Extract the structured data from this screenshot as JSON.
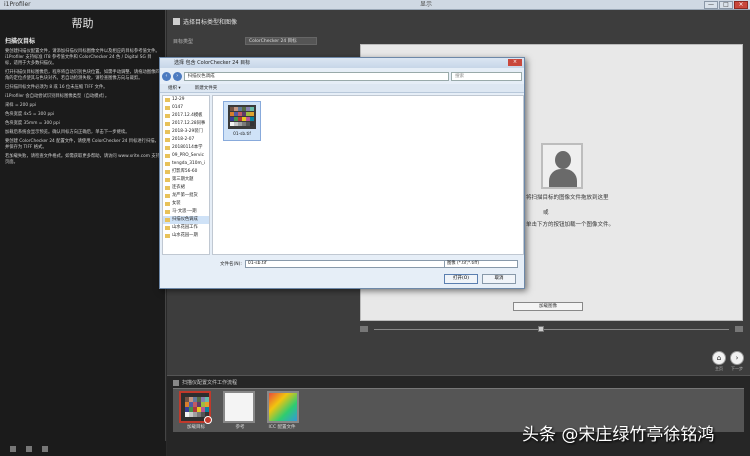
{
  "window": {
    "title": "i1Profiler",
    "center_title": "显示",
    "buttons": [
      "—",
      "□",
      "×"
    ]
  },
  "help": {
    "title": "帮助",
    "section": "扫描仪目标",
    "paragraphs": [
      "要创建扫描仪配置文件，请添加扫描仪目标图像文件以及相应的目标参考值文件。i1Profiler 支持标准 IT8 参考值文件和 ColorChecker 24 色 / Digital SG 目标，适用于大多数扫描仪。",
      "打开扫描仪目标图像后，程序将自动识别色块位置。如需手动调整，请拖动图像四角的定位点使其与色块对齐。若自动检测失败，请检查图像方向与裁剪。",
      "已扫描目标文件必须为 8 或 16 位未压缩 TIFF 文件。",
      "i1Profiler 会自动尝试识别目标图像类型（自动模式）。",
      "采样 = 200 ppi",
      "色块宽度 4x5 = 300 ppi",
      "色块宽度 35mm = 300 ppi",
      "加载后系统会显示预览。确认目标方向正确后，单击下一步继续。",
      "要创建 ColorChecker 24 配置文件，请使用 ColorChecker 24 目标进行扫描，并保存为 TIFF 格式。",
      "若加载失败，请检查文件格式。如需获取更多帮助，请访问 www.xrite.com 支持页面。"
    ]
  },
  "main": {
    "title": "选择目标类型和图像",
    "type_label": "目标类型",
    "type_value": "ColorChecker 24 目标",
    "drop_line1": "将扫描目标的图像文件拖放到这里",
    "drop_line2": "或",
    "drop_line3": "单击下方的按钮加载一个图像文件。",
    "load_button": "加载图像",
    "nav_prev": "⌂",
    "nav_next": "›",
    "nav_prev_label": "主页",
    "nav_next_label": "下一步"
  },
  "workflow": {
    "title": "扫描仪配置文件工作流程",
    "items": [
      {
        "label": "加载目标",
        "active": true
      },
      {
        "label": "参考",
        "active": false
      },
      {
        "label": "ICC 配置文件",
        "active": false
      }
    ]
  },
  "dialog": {
    "title": "选择 包含 ColorChecker 24 目标",
    "path": "扫描仪色调成",
    "search_placeholder": "搜索",
    "toolbar": [
      "组织 ▾",
      "新建文件夹"
    ],
    "folders": [
      "12-29",
      "0147",
      "2017.12.4模板",
      "2017.12.28同事",
      "2018-3-29装门",
      "2018-2-07",
      "20180114本学",
      "09_PRO_Servic",
      "tengda_310m_i",
      "打影库56-60",
      "第三期大题",
      "连衣裙",
      "龙严第一批货",
      "女装",
      "马-文思-一期",
      "扫描仪色调成",
      "山水花园工作",
      "山水花园一期"
    ],
    "selected_folder_index": 15,
    "file": {
      "name": "01-sb.tif"
    },
    "filename_label": "文件名(N):",
    "filename_value": "01-sb.tif",
    "filetype": "图像 (*.tif;*.tiff)",
    "open_button": "打开(O)",
    "cancel_button": "取消"
  },
  "watermark": "头条 @宋庄绿竹亭徐铭鸿",
  "colors": {
    "accent": "#c0392b",
    "chart_swatches": [
      "#735244",
      "#c29682",
      "#627a9d",
      "#576c43",
      "#8580b1",
      "#67bdaa",
      "#d67e2c",
      "#505ba6",
      "#c15a63",
      "#5e3c6c",
      "#9dbc40",
      "#e0a32e",
      "#383d96",
      "#469449",
      "#af363c",
      "#e7c71f",
      "#bb5695",
      "#0885a1",
      "#f3f3f2",
      "#c8c8c8",
      "#a0a0a0",
      "#7a7a79",
      "#555555",
      "#343434"
    ]
  }
}
